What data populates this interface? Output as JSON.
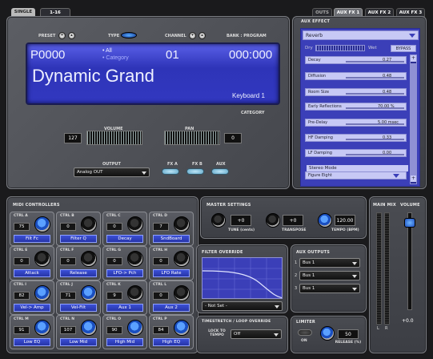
{
  "tabs": {
    "single": "SINGLE",
    "multi": "1-16"
  },
  "aux_tabs": [
    "OUTS",
    "AUX FX 1",
    "AUX FX 2",
    "AUX FX 3"
  ],
  "top": {
    "preset": "PRESET",
    "type": "TYPE",
    "channel": "CHANNEL",
    "bank_program": "BANK : PROGRAM"
  },
  "display": {
    "preset_no": "P0000",
    "filter_line1": "• All",
    "filter_line2": "• Category",
    "channel": "01",
    "bank": "000:000",
    "name": "Dynamic Grand",
    "category_value": "Keyboard 1",
    "category_label": "CATEGORY"
  },
  "volume": {
    "label": "VOLUME",
    "value": "127"
  },
  "pan": {
    "label": "PAN",
    "value": "0"
  },
  "output": {
    "label": "OUTPUT",
    "value": "Analog OUT"
  },
  "fx": {
    "a": "FX A",
    "b": "FX B",
    "aux": "AUX"
  },
  "aux_effect": {
    "label": "AUX EFFECT",
    "type": "Reverb",
    "dry": "Dry",
    "wet": "Wet",
    "bypass": "BYPASS",
    "params": [
      {
        "name": "Decay",
        "value": "0.27"
      },
      {
        "name": "Diffusion",
        "value": "0.48"
      },
      {
        "name": "Room Size",
        "value": "0.48"
      },
      {
        "name": "Early Reflections",
        "value": "70.00 %"
      },
      {
        "name": "Pre-Delay",
        "value": "5.00 msec"
      },
      {
        "name": "HF Damping",
        "value": "0.33"
      },
      {
        "name": "LF Damping",
        "value": "0.00"
      }
    ],
    "stereo_mode_label": "Stereo Mode",
    "stereo_mode_value": "Figure Eight"
  },
  "midi": {
    "title": "MIDI CONTROLLERS",
    "controls": [
      {
        "lbl": "CTRL A",
        "num": "75",
        "name": "Filt Fc",
        "blue": true
      },
      {
        "lbl": "CTRL B",
        "num": "0",
        "name": "Filter Q",
        "blue": false
      },
      {
        "lbl": "CTRL C",
        "num": "0",
        "name": "Decay",
        "blue": false
      },
      {
        "lbl": "CTRL D",
        "num": "7",
        "name": "SndBoard",
        "blue": false
      },
      {
        "lbl": "CTRL E",
        "num": "0",
        "name": "Attack",
        "blue": false
      },
      {
        "lbl": "CTRL F",
        "num": "0",
        "name": "Release",
        "blue": false
      },
      {
        "lbl": "CTRL G",
        "num": "0",
        "name": "LFO-> Pch",
        "blue": false
      },
      {
        "lbl": "CTRL H",
        "num": "0",
        "name": "LFO Rate",
        "blue": false
      },
      {
        "lbl": "CTRL I",
        "num": "82",
        "name": "Vel-> Amp",
        "blue": true
      },
      {
        "lbl": "CTRL J",
        "num": "71",
        "name": "Vel-Filt",
        "blue": true
      },
      {
        "lbl": "CTRL K",
        "num": "9",
        "name": "Aux 1",
        "blue": false
      },
      {
        "lbl": "CTRL L",
        "num": "0",
        "name": "Aux 2",
        "blue": false
      },
      {
        "lbl": "CTRL M",
        "num": "91",
        "name": "Low EQ",
        "blue": true
      },
      {
        "lbl": "CTRL N",
        "num": "107",
        "name": "Low Mid",
        "blue": true
      },
      {
        "lbl": "CTRL O",
        "num": "90",
        "name": "High Mid",
        "blue": true
      },
      {
        "lbl": "CTRL P",
        "num": "84",
        "name": "High EQ",
        "blue": true
      }
    ]
  },
  "master": {
    "title": "MASTER SETTINGS",
    "tune_value": "+0",
    "tune_label": "TUNE (cents)",
    "transpose_value": "+0",
    "transpose_label": "TRANSPOSE",
    "tempo_value": "120.00",
    "tempo_label": "TEMPO (BPM)"
  },
  "filter_override": {
    "title": "FILTER OVERRIDE",
    "value": "- Not Set -"
  },
  "tempo_override": {
    "title": "TIMESTRETCH / LOOP OVERRIDE",
    "lock_label": "LOCK TO TEMPO",
    "value": "Off"
  },
  "aux_outputs": {
    "title": "AUX OUTPUTS",
    "rows": [
      {
        "n": "1",
        "v": "Bus 1"
      },
      {
        "n": "2",
        "v": "Bus 1"
      },
      {
        "n": "3",
        "v": "Bus 1"
      }
    ]
  },
  "limiter": {
    "title": "LIMITER",
    "on": "ON",
    "release_value": "50",
    "release_label": "RELEASE (%)"
  },
  "mix": {
    "main_mix": "MAIN MIX",
    "volume": "VOLUME",
    "l": "L",
    "r": "R",
    "db": "+0.0"
  },
  "colors": {
    "lcd": "#3a40c8",
    "accent": "#2f5fe0"
  }
}
